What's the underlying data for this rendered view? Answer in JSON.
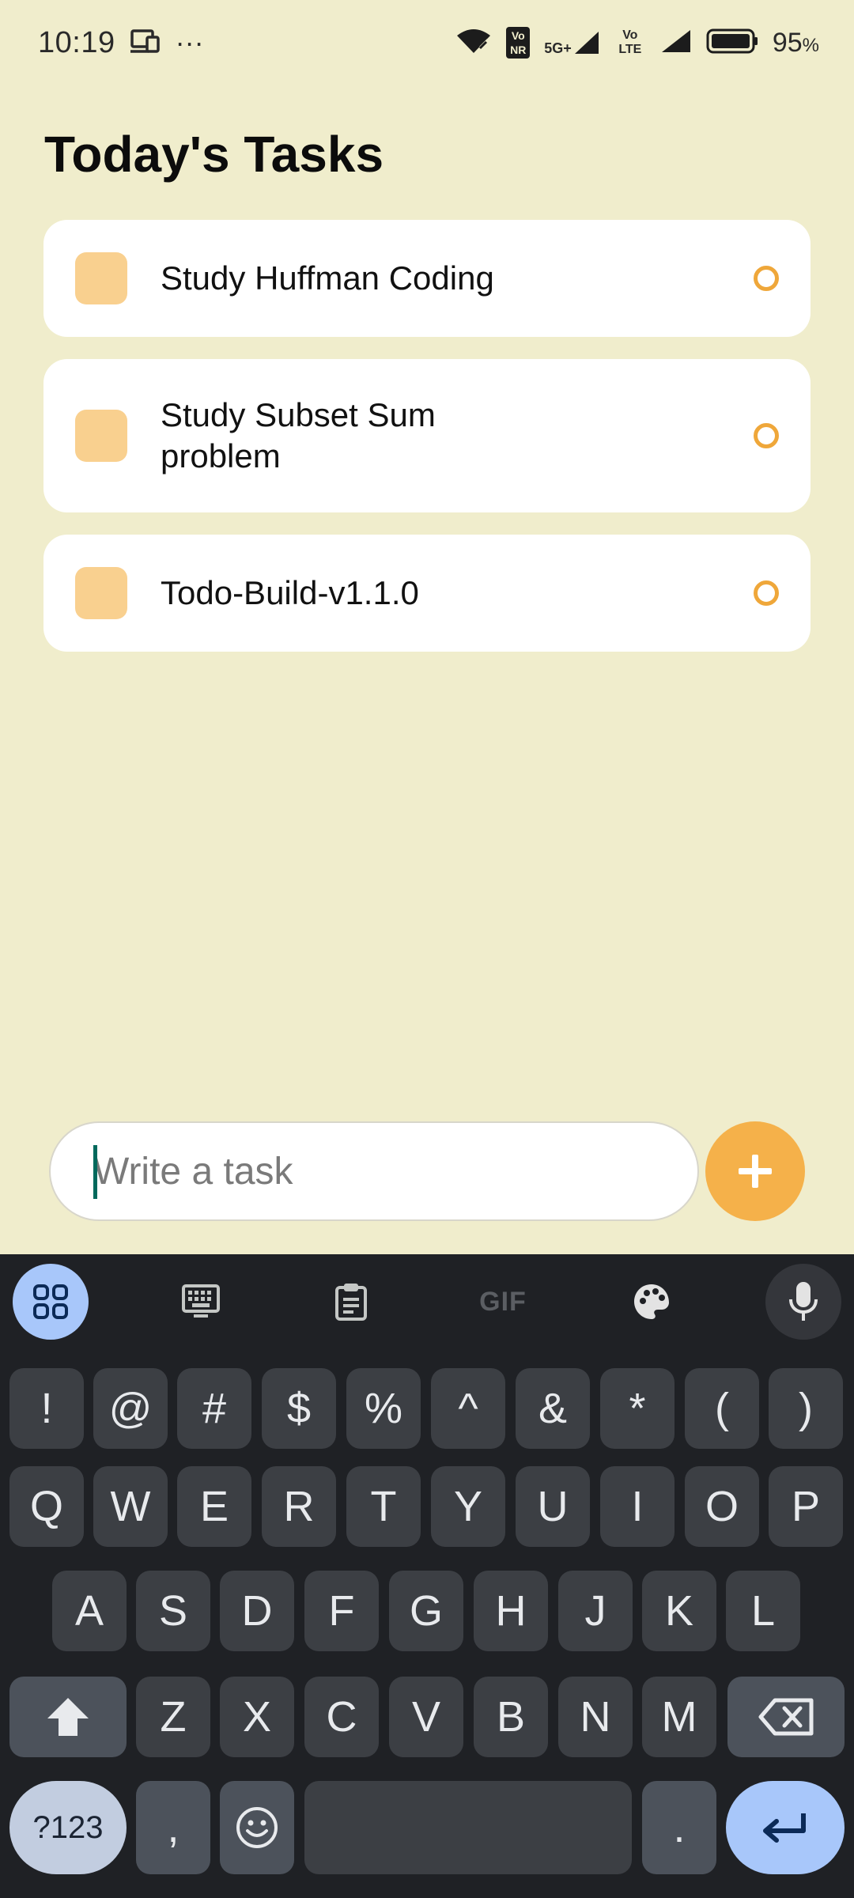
{
  "status_bar": {
    "time": "10:19",
    "more": "···",
    "network_badges": [
      "Vo NR",
      "5G+",
      "Vo LTE"
    ],
    "battery": "95",
    "battery_unit": "%"
  },
  "page": {
    "title": "Today's Tasks"
  },
  "tasks": [
    {
      "title": "Study Huffman Coding"
    },
    {
      "title": "Study Subset Sum problem"
    },
    {
      "title": "Todo-Build-v1.1.0"
    }
  ],
  "composer": {
    "placeholder": "Write a task",
    "value": ""
  },
  "keyboard": {
    "toolbar": {
      "gif": "GIF"
    },
    "row_symbols": [
      "!",
      "@",
      "#",
      "$",
      "%",
      "^",
      "&",
      "*",
      "(",
      ")"
    ],
    "row_1": [
      "Q",
      "W",
      "E",
      "R",
      "T",
      "Y",
      "U",
      "I",
      "O",
      "P"
    ],
    "row_2": [
      "A",
      "S",
      "D",
      "F",
      "G",
      "H",
      "J",
      "K",
      "L"
    ],
    "row_3": [
      "Z",
      "X",
      "C",
      "V",
      "B",
      "N",
      "M"
    ],
    "bottom": {
      "symbols_key": "?123",
      "comma": ",",
      "period": "."
    }
  },
  "colors": {
    "background": "#F0EDCC",
    "card": "#FFFFFF",
    "task_square": "#F9D08F",
    "task_circle": "#EFA73A",
    "add_button": "#F5B14A",
    "keyboard_bg": "#1F2125",
    "key": "#3C3F44",
    "accent_key": "#A8C7FA"
  }
}
